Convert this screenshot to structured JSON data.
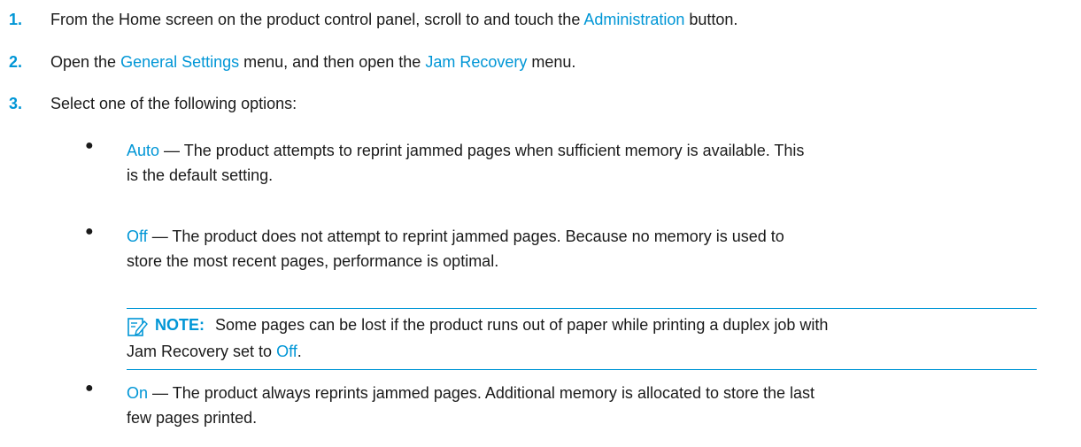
{
  "steps": [
    {
      "number": "1.",
      "pre": "From the Home screen on the product control panel, scroll to and touch the ",
      "link": "Administration",
      "post": " button."
    },
    {
      "number": "2.",
      "pre": "Open the ",
      "link1": "General Settings",
      "mid": " menu, and then open the ",
      "link2": "Jam Recovery",
      "post": " menu."
    },
    {
      "number": "3.",
      "text": "Select one of the following options:"
    }
  ],
  "options": [
    {
      "name": "Auto",
      "sep": " — ",
      "line1": "The product attempts to reprint jammed pages when sufficient memory is available. This",
      "line2": "is the default setting."
    },
    {
      "name": "Off",
      "sep": " — ",
      "line1": "The product does not attempt to reprint jammed pages. Because no memory is used to",
      "line2": "store the most recent pages, performance is optimal."
    },
    {
      "name": "On",
      "sep": " — ",
      "line1": "The product always reprints jammed pages. Additional memory is allocated to store the last",
      "line2": "few pages printed."
    }
  ],
  "note": {
    "label": "NOTE:",
    "line1": "Some pages can be lost if the product runs out of paper while printing a duplex job with",
    "line2_pre": "Jam Recovery set to ",
    "line2_link": "Off",
    "line2_post": "."
  },
  "bullet_glyph": "●",
  "icons": {
    "note": "note-pencil-icon"
  },
  "colors": {
    "accent": "#0096d6",
    "text": "#1a1a1a"
  }
}
